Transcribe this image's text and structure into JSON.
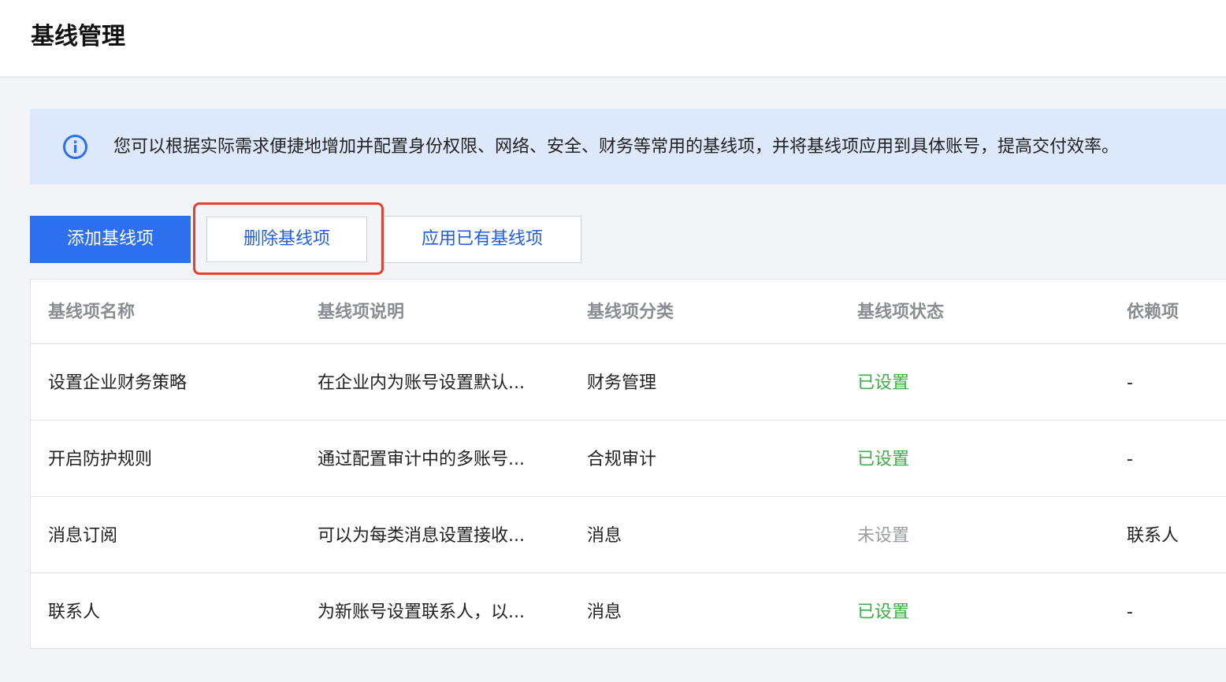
{
  "header": {
    "title": "基线管理"
  },
  "notice": {
    "icon": "info-icon",
    "text": "您可以根据实际需求便捷地增加并配置身份权限、网络、安全、财务等常用的基线项，并将基线项应用到具体账号，提高交付效率。"
  },
  "toolbar": {
    "add_label": "添加基线项",
    "delete_label": "删除基线项",
    "apply_label": "应用已有基线项"
  },
  "colors": {
    "primary": "#2e6ff0",
    "highlight": "#e3412f",
    "status_set": "#3dae48",
    "status_unset": "#9a9da3"
  },
  "table": {
    "columns": [
      "基线项名称",
      "基线项说明",
      "基线项分类",
      "基线项状态",
      "依赖项"
    ],
    "rows": [
      {
        "name": "设置企业财务策略",
        "desc": "在企业内为账号设置默认...",
        "category": "财务管理",
        "status": "已设置",
        "dependency": "-"
      },
      {
        "name": "开启防护规则",
        "desc": "通过配置审计中的多账号...",
        "category": "合规审计",
        "status": "已设置",
        "dependency": "-"
      },
      {
        "name": "消息订阅",
        "desc": "可以为每类消息设置接收...",
        "category": "消息",
        "status": "未设置",
        "dependency": "联系人"
      },
      {
        "name": "联系人",
        "desc": "为新账号设置联系人，以...",
        "category": "消息",
        "status": "已设置",
        "dependency": "-"
      }
    ]
  }
}
